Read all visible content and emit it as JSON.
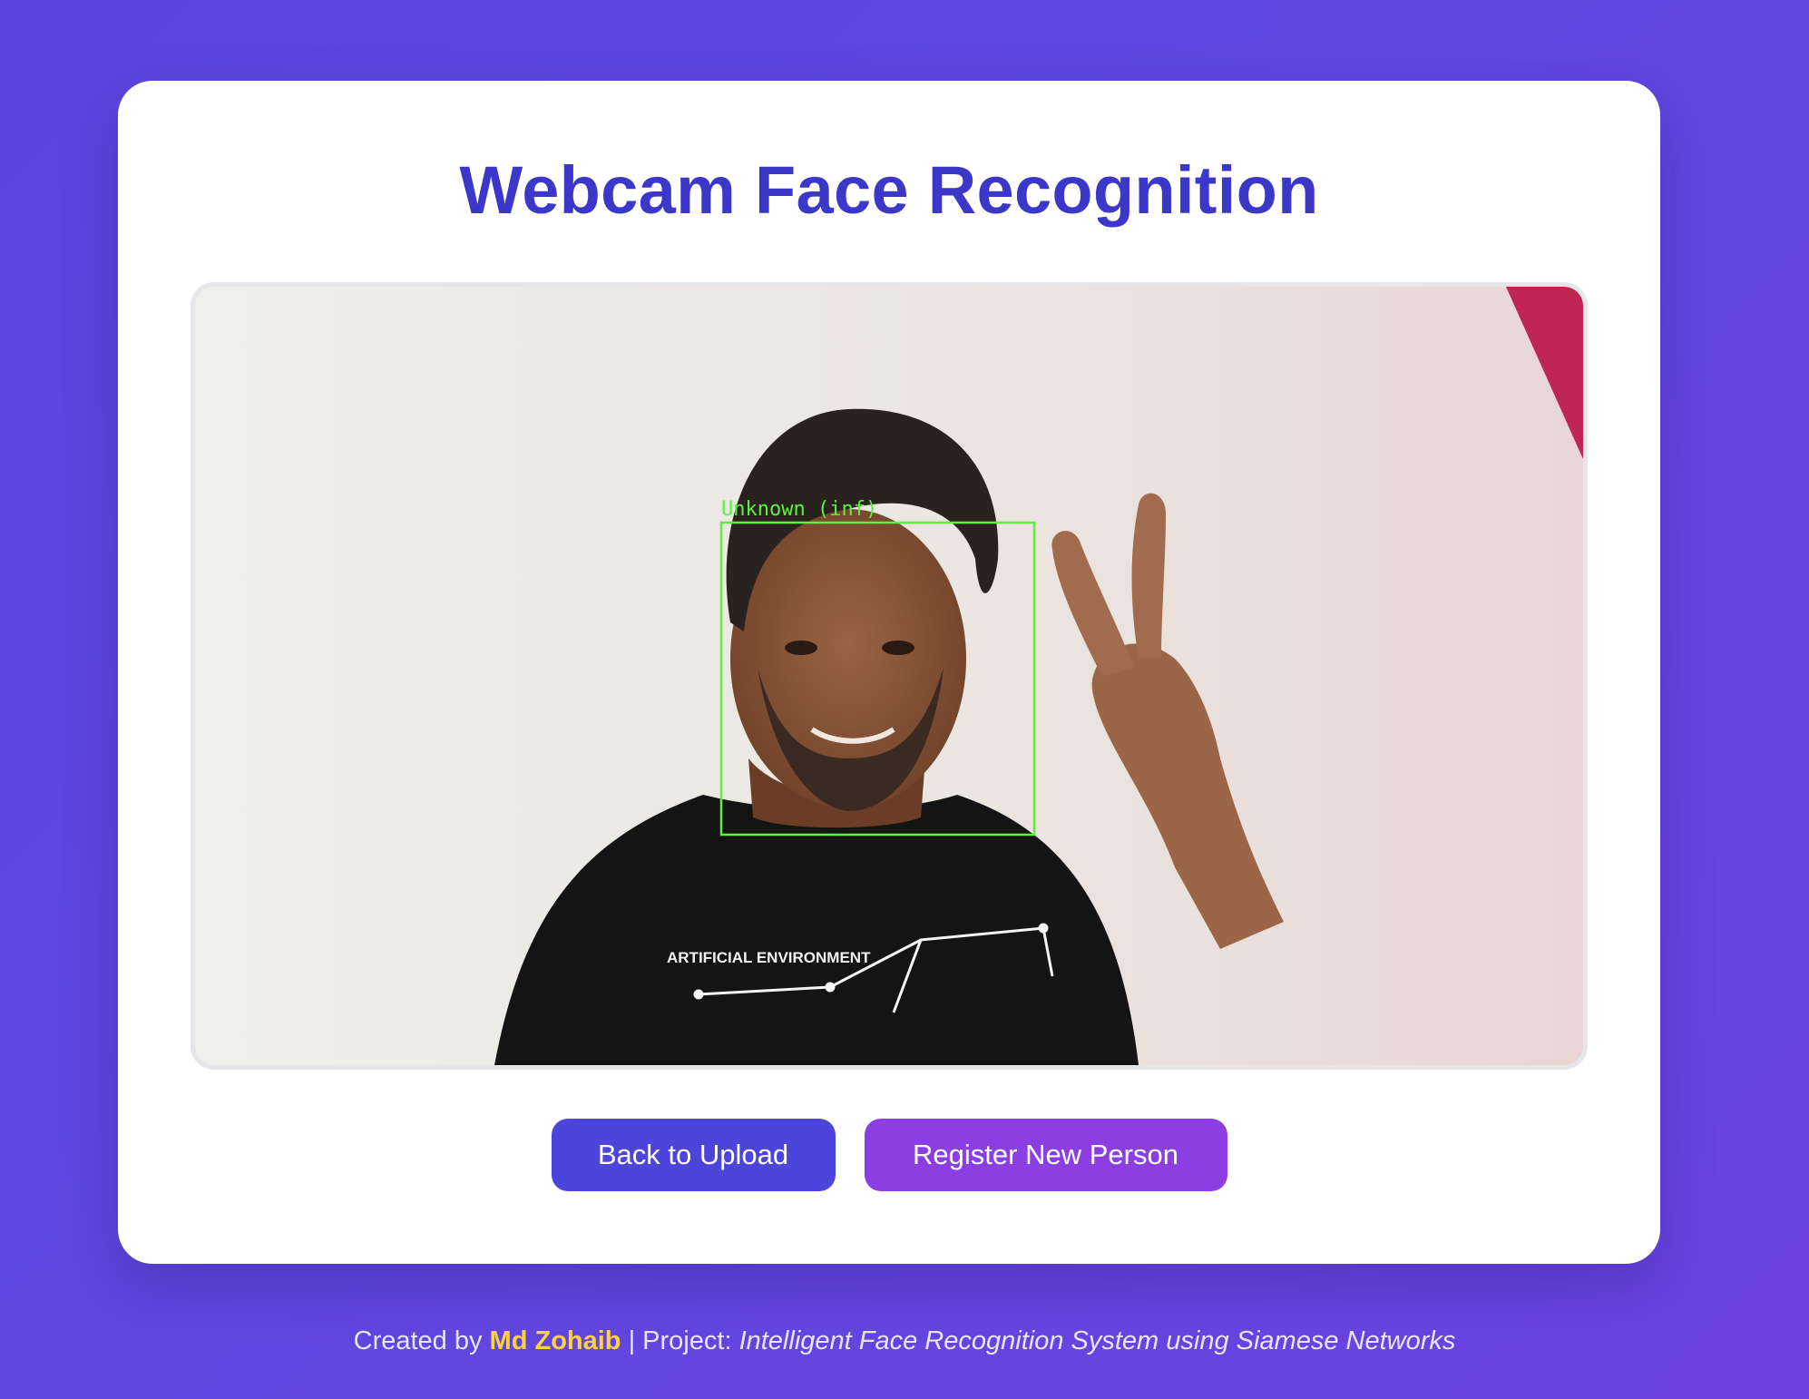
{
  "page": {
    "title": "Webcam Face Recognition"
  },
  "webcam": {
    "detection_label": "Unknown (inf)",
    "shirt_text": "ARTIFICIAL ENVIRONMENT",
    "box_color": "#5ef03c"
  },
  "actions": {
    "back_label": "Back to Upload",
    "register_label": "Register New Person"
  },
  "footer": {
    "created_by_prefix": "Created by",
    "author": "Md Zohaib",
    "separator": "| Project:",
    "project_name": "Intelligent Face Recognition System using Siamese Networks"
  },
  "colors": {
    "background": "#5f47e0",
    "title": "#3b37c9",
    "back_button": "#4c45dc",
    "register_button": "#8b3fe2",
    "author_highlight": "#fcd33f"
  }
}
